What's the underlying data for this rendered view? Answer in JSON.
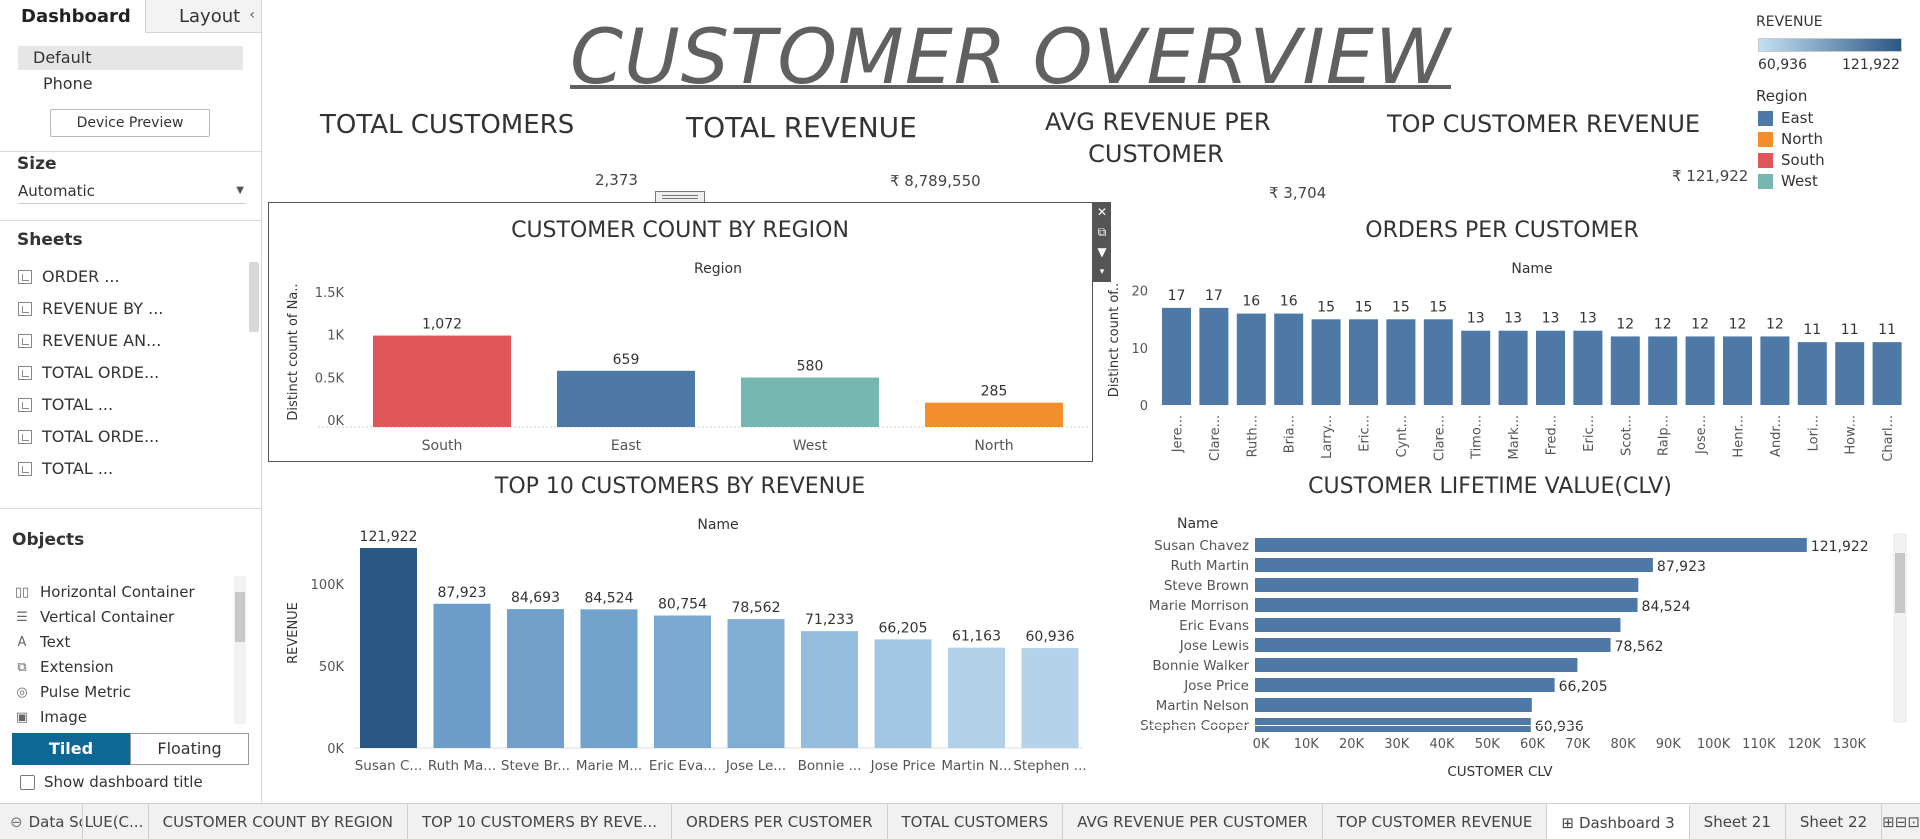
{
  "panel": {
    "tab_dashboard": "Dashboard",
    "tab_layout": "Layout",
    "device_default": "Default",
    "device_phone": "Phone",
    "device_preview": "Device Preview",
    "size_label": "Size",
    "size_value": "Automatic",
    "sheets_label": "Sheets",
    "sheets": [
      "ORDER ...",
      "REVENUE BY ...",
      "REVENUE AN...",
      "TOTAL ORDE...",
      "TOTAL ...",
      "TOTAL ORDE...",
      "TOTAL ..."
    ],
    "objects_label": "Objects",
    "objects": [
      {
        "label": "Horizontal Container",
        "icon": "horizontal-container-icon",
        "glyph": "▯▯"
      },
      {
        "label": "Vertical Container",
        "icon": "vertical-container-icon",
        "glyph": "☰"
      },
      {
        "label": "Text",
        "icon": "text-icon",
        "glyph": "A"
      },
      {
        "label": "Extension",
        "icon": "extension-icon",
        "glyph": "⧉"
      },
      {
        "label": "Pulse Metric",
        "icon": "pulse-metric-icon",
        "glyph": "◎"
      },
      {
        "label": "Image",
        "icon": "image-icon",
        "glyph": "▣"
      }
    ],
    "tiled": "Tiled",
    "floating": "Floating",
    "show_title": "Show dashboard title"
  },
  "dashboard": {
    "title": "CUSTOMER OVERVIEW",
    "kpis": {
      "total_customers_label": "TOTAL CUSTOMERS",
      "total_customers_value": "2,373",
      "total_revenue_label": "TOTAL REVENUE",
      "total_revenue_value": "₹ 8,789,550",
      "avg_revenue_label_1": "AVG REVENUE PER",
      "avg_revenue_label_2": "CUSTOMER",
      "avg_revenue_value": "₹ 3,704",
      "top_customer_label": "TOP CUSTOMER REVENUE",
      "top_customer_value": "₹ 121,922"
    },
    "legend": {
      "revenue_title": "REVENUE",
      "revenue_min": "60,936",
      "revenue_max": "121,922",
      "region_title": "Region",
      "regions": [
        {
          "name": "East",
          "color": "#4e79a7"
        },
        {
          "name": "North",
          "color": "#f28e2b"
        },
        {
          "name": "South",
          "color": "#e15759"
        },
        {
          "name": "West",
          "color": "#76b7b2"
        }
      ]
    }
  },
  "chart_data": [
    {
      "id": "customer-count-by-region",
      "type": "bar",
      "title": "CUSTOMER COUNT BY REGION",
      "header": "Region",
      "ylabel": "Distinct count of Na..",
      "categories": [
        "South",
        "East",
        "West",
        "North"
      ],
      "values": [
        1072,
        659,
        580,
        285
      ],
      "value_labels": [
        "1,072",
        "659",
        "580",
        "285"
      ],
      "colors": [
        "#e15759",
        "#4e79a7",
        "#76b7b2",
        "#f28e2b"
      ],
      "yticks": [
        {
          "v": 0,
          "l": "0K"
        },
        {
          "v": 500,
          "l": "0.5K"
        },
        {
          "v": 1000,
          "l": "1K"
        },
        {
          "v": 1500,
          "l": "1.5K"
        }
      ],
      "ylim": [
        0,
        1700
      ]
    },
    {
      "id": "orders-per-customer",
      "type": "bar",
      "title": "ORDERS PER CUSTOMER",
      "header": "Name",
      "ylabel": "Distinct count of..",
      "categories": [
        "Jere...",
        "Clare...",
        "Ruth...",
        "Bria...",
        "Larry...",
        "Eric...",
        "Cynt...",
        "Clare...",
        "Timo...",
        "Mark...",
        "Fred...",
        "Eric...",
        "Scot...",
        "Ralp...",
        "Jose...",
        "Henr...",
        "Andr...",
        "Lori...",
        "How...",
        "Charl..."
      ],
      "values": [
        17,
        17,
        16,
        16,
        15,
        15,
        15,
        15,
        13,
        13,
        13,
        13,
        12,
        12,
        12,
        12,
        12,
        11,
        11,
        11
      ],
      "color": "#4e79a7",
      "yticks": [
        {
          "v": 0,
          "l": "0"
        },
        {
          "v": 10,
          "l": "10"
        },
        {
          "v": 20,
          "l": "20"
        }
      ],
      "ylim": [
        0,
        21
      ]
    },
    {
      "id": "top-10-customers-by-revenue",
      "type": "bar",
      "title": "TOP 10 CUSTOMERS BY REVENUE",
      "header": "Name",
      "ylabel": "REVENUE",
      "categories": [
        "Susan C...",
        "Ruth Ma...",
        "Steve Br...",
        "Marie M...",
        "Eric Eva...",
        "Jose Le...",
        "Bonnie ...",
        "Jose Price",
        "Martin N...",
        "Stephen ..."
      ],
      "values": [
        121922,
        87923,
        84693,
        84524,
        80754,
        78562,
        71233,
        66205,
        61163,
        60936
      ],
      "value_labels": [
        "121,922",
        "87,923",
        "84,693",
        "84,524",
        "80,754",
        "78,562",
        "71,233",
        "66,205",
        "61,163",
        "60,936"
      ],
      "colors": [
        "#2a5783",
        "#6d9ec9",
        "#71a1cb",
        "#71a2cc",
        "#7aa8d0",
        "#80add3",
        "#94bcdd",
        "#a3c6e3",
        "#b3d0e9",
        "#b5d2ea"
      ],
      "yticks": [
        {
          "v": 0,
          "l": "0K"
        },
        {
          "v": 50000,
          "l": "50K"
        },
        {
          "v": 100000,
          "l": "100K"
        }
      ],
      "ylim": [
        0,
        128000
      ]
    },
    {
      "id": "customer-lifetime-value",
      "type": "bar",
      "orientation": "horizontal",
      "title": "CUSTOMER LIFETIME VALUE(CLV)",
      "row_header": "Name",
      "xlabel": "CUSTOMER CLV",
      "categories": [
        "Susan Chavez",
        "Ruth Martin",
        "Steve Brown",
        "Marie Morrison",
        "Eric Evans",
        "Jose Lewis",
        "Bonnie Walker",
        "Jose Price",
        "Martin Nelson",
        "Stephen Cooper"
      ],
      "values": [
        121922,
        87923,
        84693,
        84524,
        80754,
        78562,
        71233,
        66205,
        61163,
        60936
      ],
      "value_labels": [
        "121,922",
        "87,923",
        "",
        "84,524",
        "",
        "78,562",
        "",
        "66,205",
        "",
        "60,936"
      ],
      "color": "#4e79a7",
      "xticks": [
        "0K",
        "10K",
        "20K",
        "30K",
        "40K",
        "50K",
        "60K",
        "70K",
        "80K",
        "90K",
        "100K",
        "110K",
        "120K",
        "130K"
      ],
      "xlim": [
        0,
        135000
      ]
    }
  ],
  "tabs": {
    "data_source": "Data Source",
    "items": [
      "LUE(C...",
      "CUSTOMER COUNT BY REGION",
      "TOP 10 CUSTOMERS BY REVE...",
      "ORDERS PER CUSTOMER",
      "TOTAL CUSTOMERS",
      "AVG REVENUE PER CUSTOMER",
      "TOP CUSTOMER REVENUE",
      "Dashboard 3",
      "Sheet 21",
      "Sheet 22"
    ],
    "active": "Dashboard 3"
  }
}
